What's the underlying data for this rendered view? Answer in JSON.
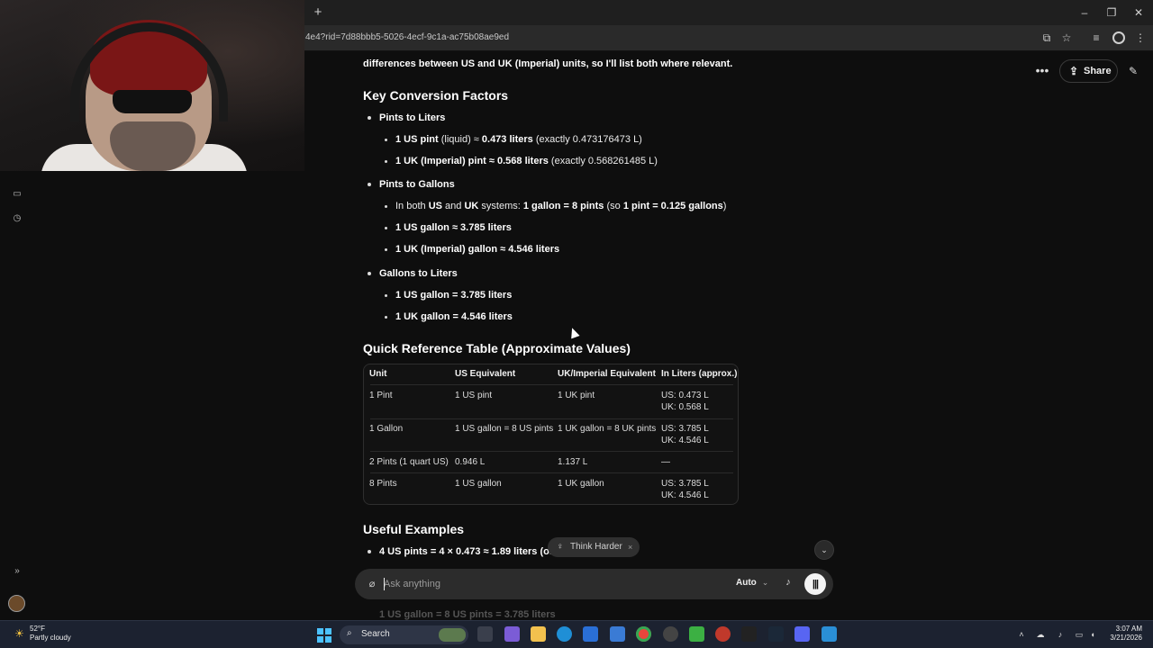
{
  "browser": {
    "url": "4e4?rid=7d88bbb5-5026-4ecf-9c1a-ac75b08ae9ed",
    "new_tab": "+",
    "win_min": "–",
    "win_max": "❐",
    "win_close": "✕"
  },
  "top_actions": {
    "more": "•••",
    "share": "Share"
  },
  "content": {
    "intro_pre": "differences between ",
    "intro_b1": "US",
    "intro_mid": " and ",
    "intro_b2": "UK (Imperial)",
    "intro_post": " units, so I'll list both where relevant.",
    "h_factors": "Key Conversion Factors",
    "s1_title": "Pints to Liters",
    "s1_a_b1": "1 US pint",
    "s1_a_t1": " (liquid) ≈ ",
    "s1_a_b2": "0.473 liters",
    "s1_a_t2": " (exactly 0.473176473 L)",
    "s1_b_b1": "1 UK (Imperial) pint ≈ 0.568 liters",
    "s1_b_t1": " (exactly 0.568261485 L)",
    "s2_title": "Pints to Gallons",
    "s2_a_t1": "In both ",
    "s2_a_b1": "US",
    "s2_a_t2": " and ",
    "s2_a_b2": "UK",
    "s2_a_t3": " systems: ",
    "s2_a_b3": "1 gallon = 8 pints",
    "s2_a_t4": " (so ",
    "s2_a_b4": "1 pint = 0.125 gallons",
    "s2_a_t5": ")",
    "s2_b": "1 US gallon ≈ 3.785 liters",
    "s2_c": "1 UK (Imperial) gallon ≈ 4.546 liters",
    "s3_title": "Gallons to Liters",
    "s3_a": "1 US gallon = 3.785 liters",
    "s3_b": "1 UK gallon = 4.546 liters",
    "h_table": "Quick Reference Table (Approximate Values)",
    "h_examples": "Useful Examples",
    "ex1_t1": "4 US pints = 4 × 0.473 ≈ ",
    "ex1_b1": "1.89 liters",
    "ex1_t2": " (or",
    "peek": "1 US gallon = 8 US pints = 3.785 liters"
  },
  "table": {
    "headers": [
      "Unit",
      "US Equivalent",
      "UK/Imperial Equivalent",
      "In Liters (approx.)"
    ],
    "rows": [
      {
        "unit": "1 Pint",
        "us": "1 US pint",
        "uk": "1 UK pint",
        "l1": "US: 0.473 L",
        "l2": "UK: 0.568 L"
      },
      {
        "unit": "1 Gallon",
        "us": "1 US gallon = 8 US pints",
        "uk": "1 UK gallon = 8 UK pints",
        "l1": "US: 3.785 L",
        "l2": "UK: 4.546 L"
      },
      {
        "unit": "2 Pints (1 quart US)",
        "us": "0.946 L",
        "uk": "1.137 L",
        "l1": "—",
        "l2": ""
      },
      {
        "unit": "8 Pints",
        "us": "1 US gallon",
        "uk": "1 UK gallon",
        "l1": "US: 3.785 L",
        "l2": "UK: 4.546 L"
      }
    ]
  },
  "chip": {
    "label": "Think Harder",
    "close": "×"
  },
  "composer": {
    "placeholder": "Ask anything",
    "model": "Auto"
  },
  "taskbar": {
    "temp": "52°F",
    "weather": "Partly cloudy",
    "search": "Search",
    "time": "3:07 AM",
    "date": "3/21/2026"
  }
}
